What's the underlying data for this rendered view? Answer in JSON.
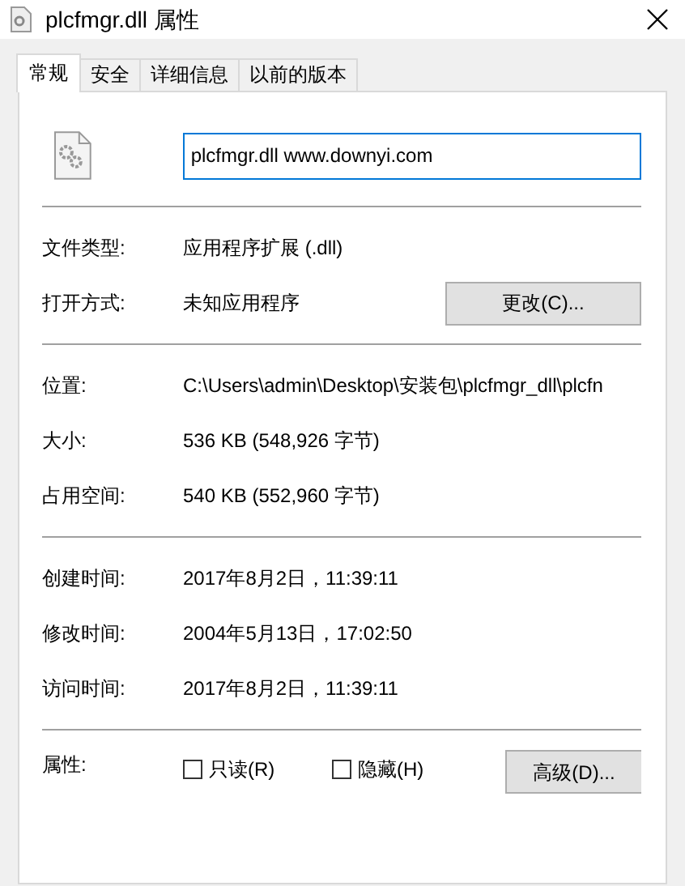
{
  "window": {
    "title": "plcfmgr.dll 属性"
  },
  "tabs": [
    {
      "label": "常规",
      "selected": true
    },
    {
      "label": "安全",
      "selected": false
    },
    {
      "label": "详细信息",
      "selected": false
    },
    {
      "label": "以前的版本",
      "selected": false
    }
  ],
  "file_name": {
    "value": "plcfmgr.dll www.downyi.com"
  },
  "sections": [
    [
      {
        "label": "文件类型:",
        "value": "应用程序扩展 (.dll)"
      },
      {
        "label": "打开方式:",
        "value": "未知应用程序",
        "button": "更改(C)..."
      }
    ],
    [
      {
        "label": "位置:",
        "value": "C:\\Users\\admin\\Desktop\\安装包\\plcfmgr_dll\\plcfn"
      },
      {
        "label": "大小:",
        "value": "536 KB (548,926 字节)"
      },
      {
        "label": "占用空间:",
        "value": "540 KB (552,960 字节)"
      }
    ],
    [
      {
        "label": "创建时间:",
        "value": "2017年8月2日，11:39:11"
      },
      {
        "label": "修改时间:",
        "value": "2004年5月13日，17:02:50"
      },
      {
        "label": "访问时间:",
        "value": "2017年8月2日，11:39:11"
      }
    ]
  ],
  "attributes": {
    "label": "属性:",
    "checkboxes": [
      {
        "label": "只读(R)",
        "checked": false
      },
      {
        "label": "隐藏(H)",
        "checked": false
      }
    ],
    "button": "高级(D)..."
  }
}
